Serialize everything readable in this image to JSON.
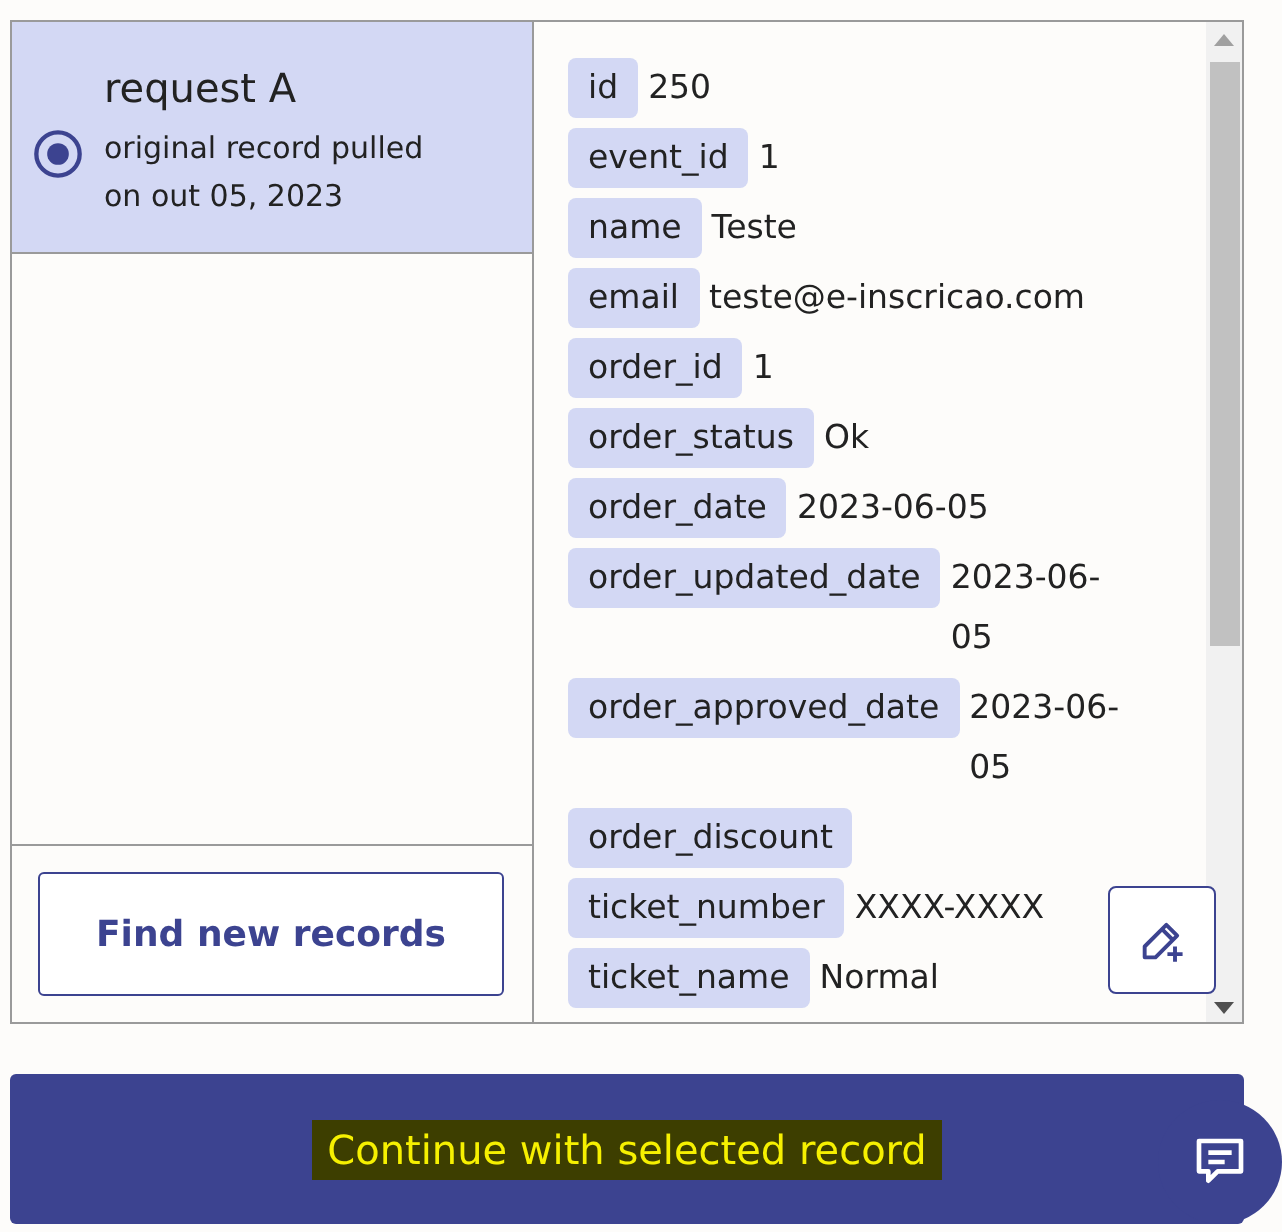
{
  "records": [
    {
      "title": "request A",
      "subtitle": "original record pulled on out 05, 2023",
      "selected": true
    }
  ],
  "find_button": "Find new records",
  "fields": [
    {
      "key": "id",
      "value": "250"
    },
    {
      "key": "event_id",
      "value": "1"
    },
    {
      "key": "name",
      "value": "Teste"
    },
    {
      "key": "email",
      "value": "teste@e-inscricao.com"
    },
    {
      "key": "order_id",
      "value": "1"
    },
    {
      "key": "order_status",
      "value": "Ok"
    },
    {
      "key": "order_date",
      "value": "2023-06-05"
    },
    {
      "key": "order_updated_date",
      "value": "2023-06-05"
    },
    {
      "key": "order_approved_date",
      "value": "2023-06-05"
    },
    {
      "key": "order_discount"
    },
    {
      "key": "ticket_number",
      "value": "XXXX-XXXX"
    },
    {
      "key": "ticket_name",
      "value": "Normal"
    }
  ],
  "continue_button": {
    "label": "Continue with selected record",
    "highlighted": true
  }
}
